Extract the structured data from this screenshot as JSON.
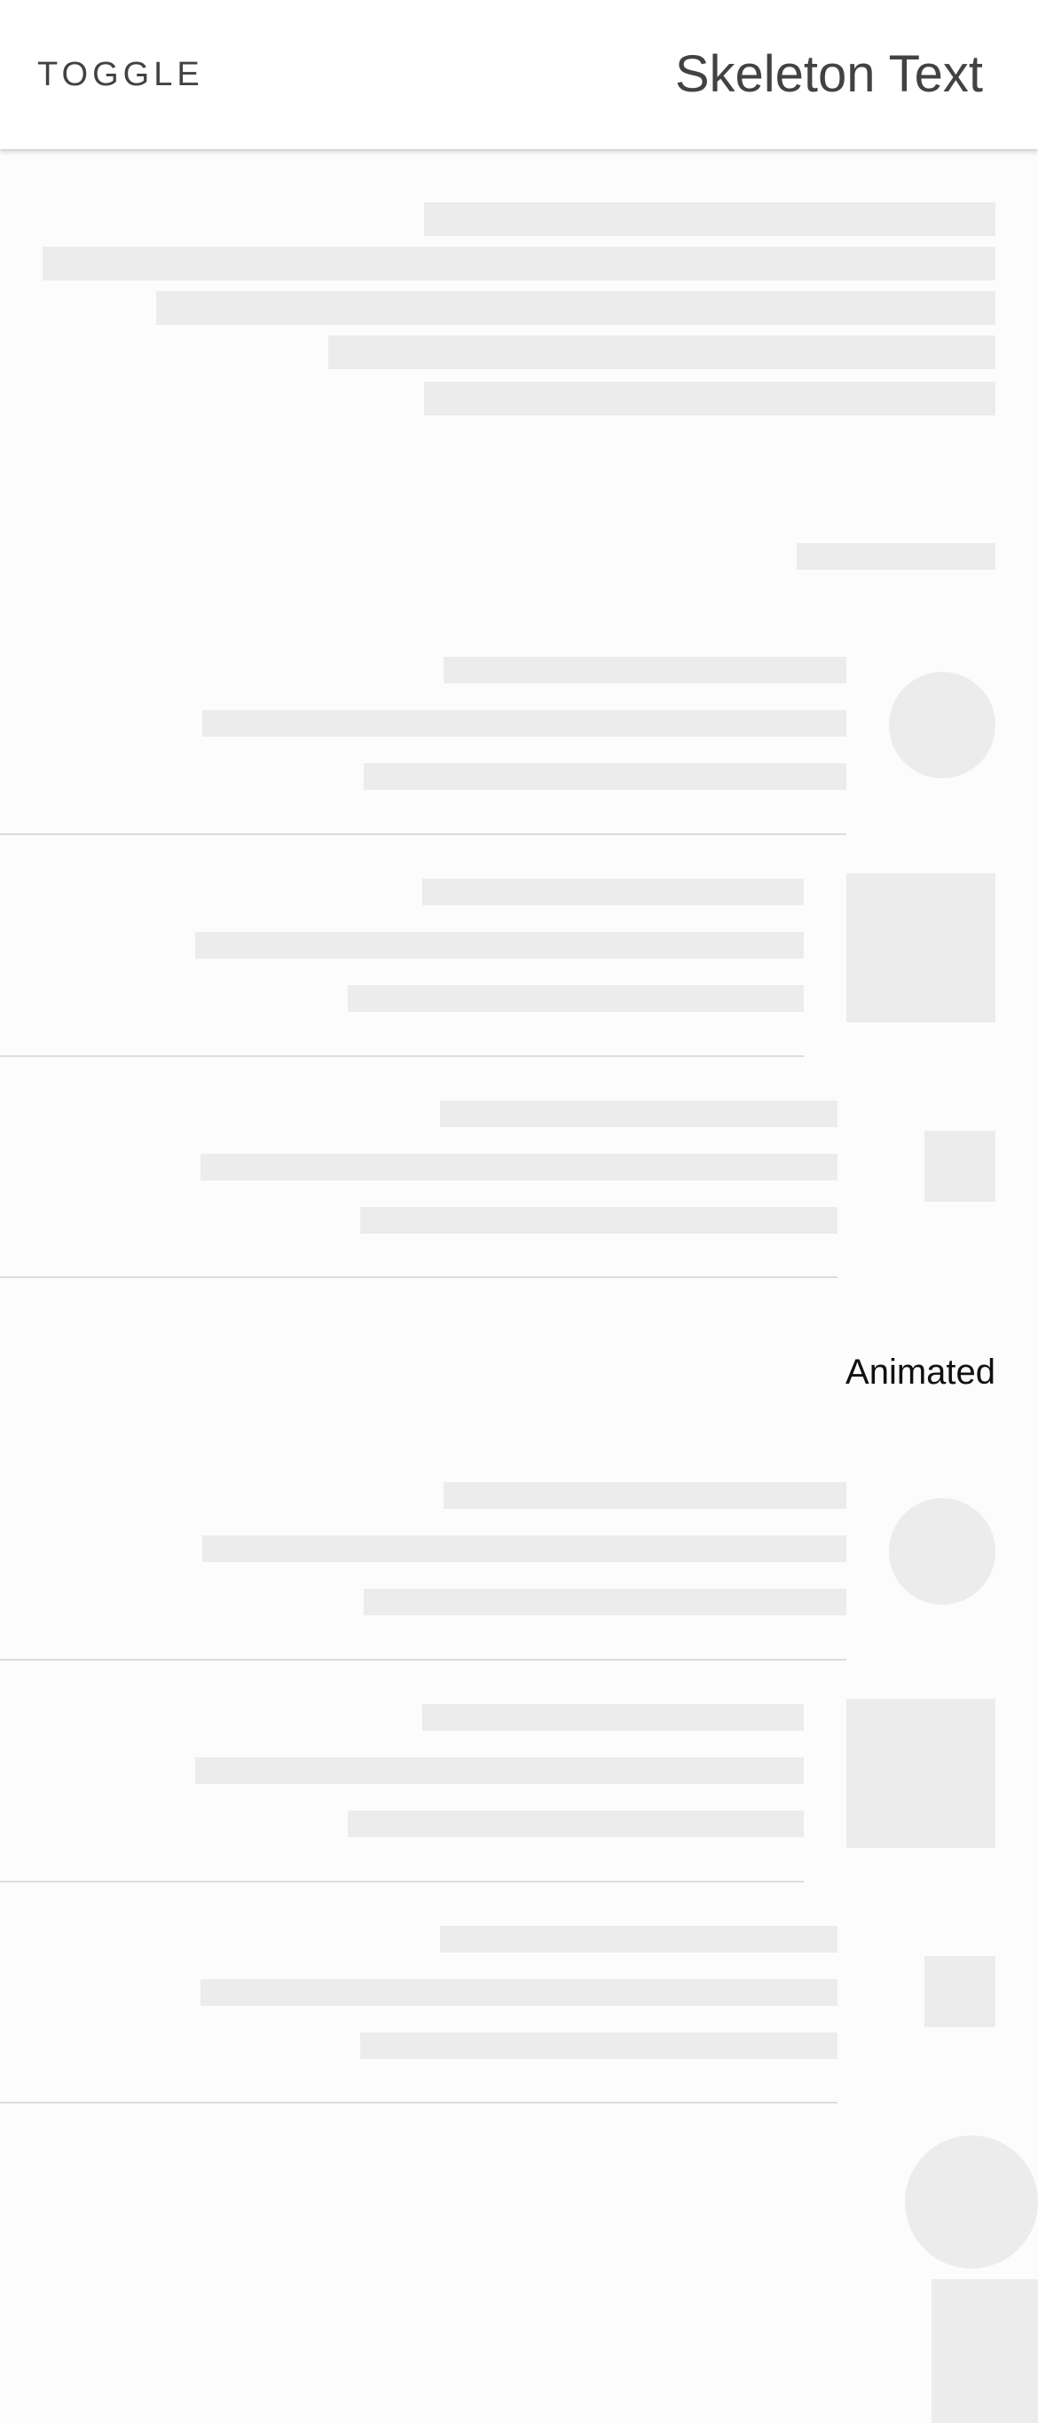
{
  "toolbar": {
    "toggle_label": "TOGGLE",
    "title": "Skeleton Text"
  },
  "animated_section": {
    "label": "Animated"
  },
  "colors": {
    "skeleton": "#ececec",
    "divider": "#dcdcdc",
    "toolbar_background": "#ffffff",
    "page_background": "#fcfcfc",
    "title_text": "#424242"
  }
}
